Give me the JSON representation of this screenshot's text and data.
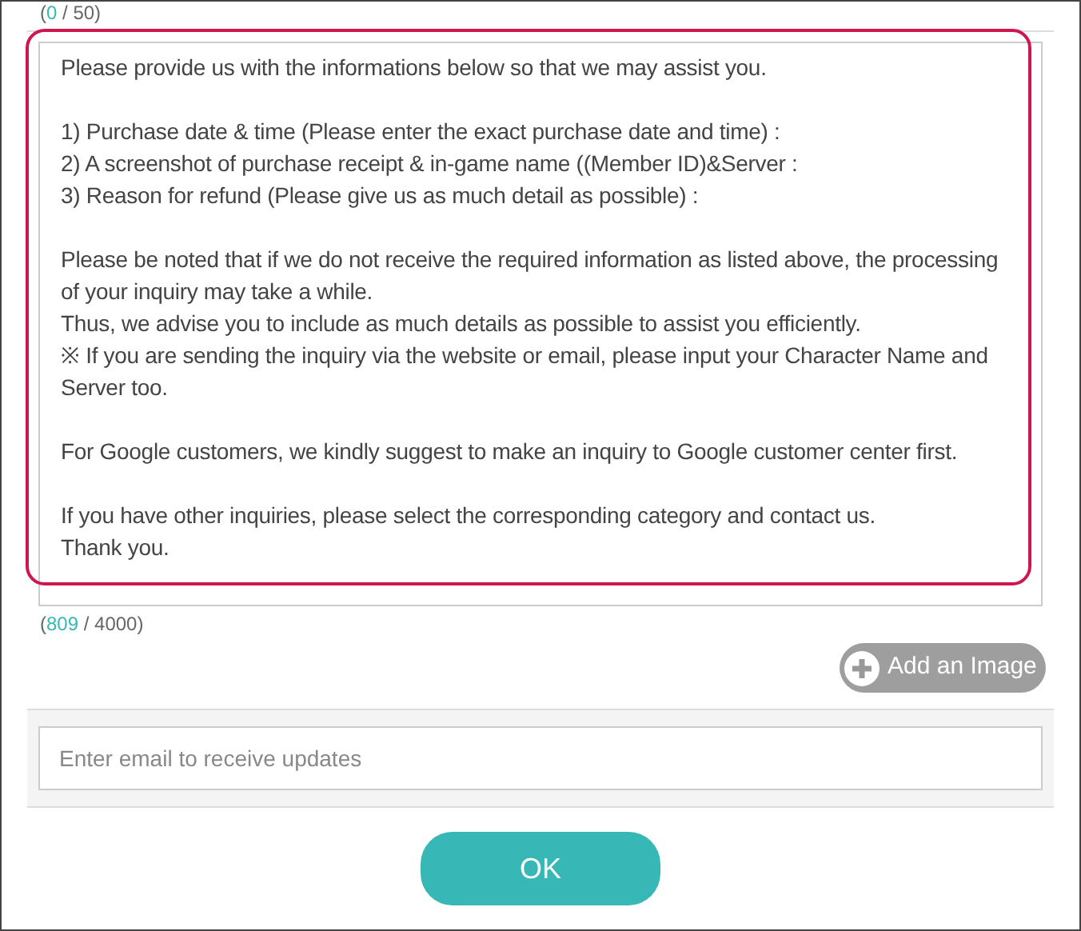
{
  "title_counter": {
    "prefix": "(",
    "value": "0",
    "suffix": " / 50)"
  },
  "message": {
    "paragraphs": [
      "Please provide us with the informations below so that we may assist you.",
      "1) Purchase date & time (Please enter the exact purchase date and time) :\n2) A screenshot of purchase receipt & in-game name ((Member ID)&Server :\n3) Reason for refund (Please give us as much detail as possible) :",
      "Please be noted that if we do not receive the required information as listed above, the processing of your inquiry may take a while.\nThus, we advise you to include as much details as possible to assist you efficiently.\n※ If you are sending the inquiry via the website or email, please input your Character Name and Server too.",
      "For Google customers, we kindly suggest to make an inquiry to Google customer center first.",
      "If you have other inquiries, please select the corresponding category and contact us.\nThank you."
    ],
    "highlighted": true
  },
  "message_counter": {
    "prefix": "(",
    "value": "809",
    "suffix": " / 4000)"
  },
  "add_image_button": "Add an Image",
  "email_field": {
    "placeholder": "Enter email to receive updates"
  },
  "ok_button": "OK"
}
